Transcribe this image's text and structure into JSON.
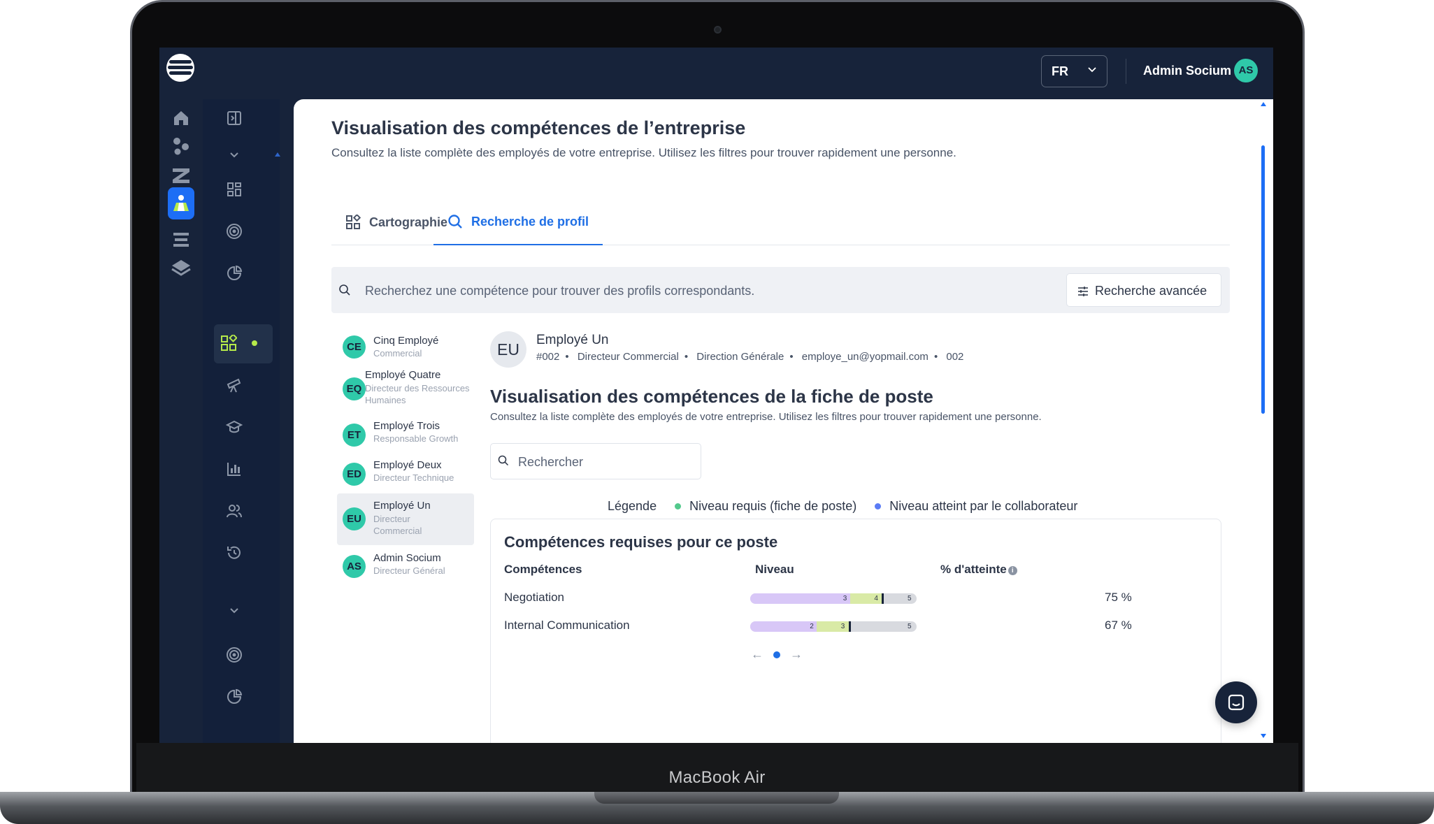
{
  "device": {
    "label": "MacBook Air"
  },
  "topbar": {
    "language": "FR",
    "user_name": "Admin Socium",
    "user_initials": "AS"
  },
  "rail": {
    "icons": [
      "home-icon",
      "network-icon",
      "z-logo-icon",
      "skills-app-icon",
      "stack-icon",
      "layers-icon"
    ]
  },
  "sidebar": {
    "icons": [
      "collapse-panel-icon",
      "chevron-down-icon",
      "dashboard-grid-icon",
      "target-icon",
      "pie-chart-icon",
      "skills-grid-icon",
      "telescope-icon",
      "graduation-cap-icon",
      "bar-chart-icon",
      "users-icon",
      "history-icon",
      "chevron-down-icon",
      "target-icon",
      "pie-chart-icon"
    ]
  },
  "page": {
    "title": "Visualisation des compétences de l’entreprise",
    "description": "Consultez la liste complète des employés de votre entreprise. Utilisez les filtres pour trouver rapidement une personne."
  },
  "tabs": [
    {
      "label": "Cartographie",
      "icon": "map-grid-icon",
      "active": false
    },
    {
      "label": "Recherche de profil",
      "icon": "search-icon",
      "active": true
    }
  ],
  "search": {
    "placeholder": "Recherchez une compétence pour trouver des profils correspondants.",
    "advanced_label": "Recherche avancée"
  },
  "employees": [
    {
      "initials": "CE",
      "name": "Cinq Employé",
      "role": "Commercial",
      "selected": false
    },
    {
      "initials": "EQ",
      "name": "Employé Quatre",
      "role": "Directeur des Ressources Humaines",
      "selected": false
    },
    {
      "initials": "ET",
      "name": "Employé Trois",
      "role": "Responsable Growth",
      "selected": false
    },
    {
      "initials": "ED",
      "name": "Employé Deux",
      "role": "Directeur Technique",
      "selected": false
    },
    {
      "initials": "EU",
      "name": "Employé Un",
      "role": "Directeur Commercial",
      "selected": true
    },
    {
      "initials": "AS",
      "name": "Admin Socium",
      "role": "Directeur Général",
      "selected": false
    }
  ],
  "profile": {
    "initials": "EU",
    "name": "Employé Un",
    "id": "#002",
    "role": "Directeur Commercial",
    "department": "Direction Générale",
    "email": "employe_un@yopmail.com",
    "code": "002"
  },
  "skills_section": {
    "title": "Visualisation des compétences de la fiche de poste",
    "description": "Consultez la liste complète des employés de votre entreprise. Utilisez les filtres pour trouver rapidement une personne.",
    "search_placeholder": "Rechercher"
  },
  "legend": {
    "label": "Légende",
    "required": "Niveau requis (fiche de poste)",
    "achieved": "Niveau atteint par le collaborateur",
    "required_color": "#53c98c",
    "achieved_color": "#5b7cf5"
  },
  "skills_table": {
    "title": "Compétences requises pour ce poste",
    "headers": {
      "skill": "Compétences",
      "level": "Niveau",
      "pct": "% d'atteinte"
    },
    "max_level": 5,
    "rows": [
      {
        "name": "Negotiation",
        "achieved": 3,
        "required": 4,
        "max": 5,
        "max_label": "5",
        "achieved_label": "3",
        "required_label": "4",
        "pct": "75 %"
      },
      {
        "name": "Internal Communication",
        "achieved": 2,
        "required": 3,
        "max": 5,
        "max_label": "5",
        "achieved_label": "2",
        "required_label": "3",
        "pct": "67 %"
      }
    ],
    "pager": {
      "prev": "←",
      "next": "→"
    }
  },
  "colors": {
    "navy": "#17233a",
    "accent_blue": "#1f6fe5",
    "avatar_teal": "#2fc9a9",
    "bar_achieved": "#d8c7f7",
    "bar_required": "#d9eaa6",
    "bar_track": "#d8dadf"
  }
}
